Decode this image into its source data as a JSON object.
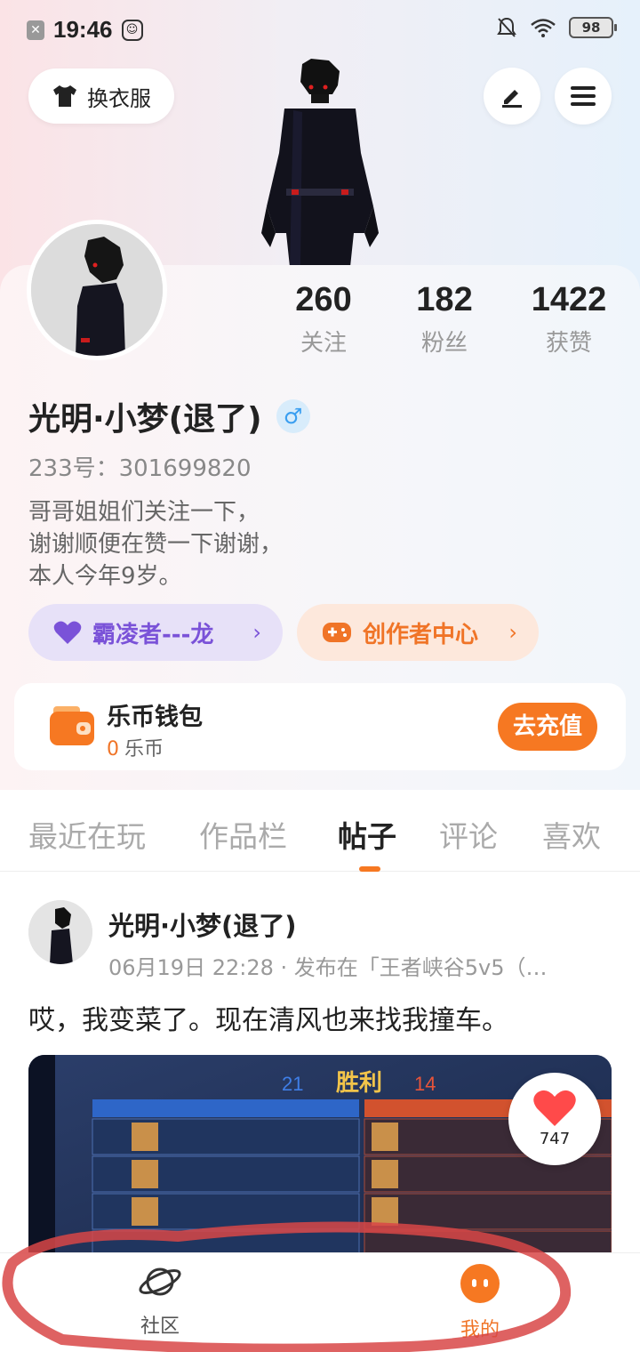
{
  "status_bar": {
    "time": "19:46",
    "battery": "98"
  },
  "header": {
    "outfit_label": "换衣服",
    "edit_icon": "pen-icon",
    "menu_icon": "menu-icon"
  },
  "profile": {
    "stats": [
      {
        "num": "260",
        "label": "关注"
      },
      {
        "num": "182",
        "label": "粉丝"
      },
      {
        "num": "1422",
        "label": "获赞"
      }
    ],
    "name": "光明·小梦(退了)",
    "gender_symbol": "♂",
    "uid": "233号：301699820",
    "bio": [
      "哥哥姐姐们关注一下，",
      "谢谢顺便在赞一下谢谢，",
      "本人今年9岁。"
    ],
    "badge_label": "霸凌者---龙",
    "creator_label": "创作者中心"
  },
  "wallet": {
    "title": "乐币钱包",
    "balance": "0",
    "unit": "乐币",
    "recharge": "去充值"
  },
  "tabs": [
    "最近在玩",
    "作品栏",
    "帖子",
    "评论",
    "喜欢"
  ],
  "post": {
    "author": "光明·小梦(退了)",
    "meta": "06月19日 22:28 · 发布在「王者峡谷5v5（…",
    "text": "哎，我变菜了。现在清风也来找我撞车。",
    "image_text": {
      "score_left": "21",
      "result": "胜利",
      "score_right": "14"
    },
    "likes": "747"
  },
  "bottom_nav": {
    "community": "社区",
    "mine": "我的"
  },
  "colors": {
    "accent": "#f67822",
    "purple": "#7a52d8"
  }
}
